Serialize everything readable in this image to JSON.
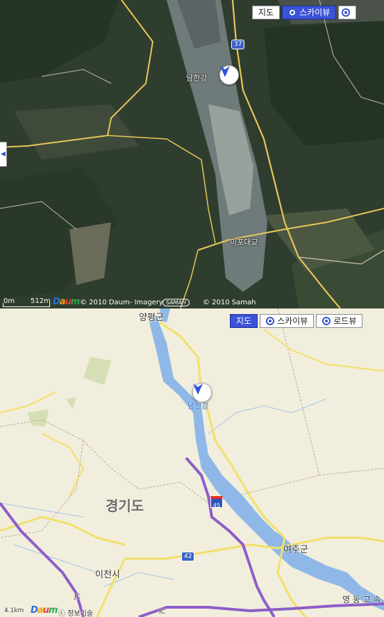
{
  "satellite": {
    "maptype_buttons": [
      "지도",
      "스카이뷰",
      ""
    ],
    "active_button": "스카이뷰",
    "labels": {
      "river": "남한강",
      "bridge": "이포대교",
      "road_37": "37"
    },
    "scale_zero": "0m",
    "scale_value": "512m",
    "copyright_daum": "© 2010 Daum- Imagery",
    "samah_logo": "SAMAH",
    "copyright_samah": "© 2010 Samah",
    "logo": {
      "d": "D",
      "a": "a",
      "u": "u",
      "m": "m"
    }
  },
  "map": {
    "maptype_buttons": [
      "지도",
      "스카이뷰",
      "로드뷰"
    ],
    "active_button": "지도",
    "labels": {
      "yangpyeong": "양평군",
      "river": "남한강",
      "gyeonggi": "경기도",
      "yeoju": "여주군",
      "icheon": "이천시",
      "expressway": "영 동  고 속",
      "jc": "JC",
      "ic": "IC",
      "road_42": "42",
      "hw_45": "45"
    },
    "scale_value": "4.1km",
    "copyright": "ⓒ 정보기술",
    "logo": {
      "d": "D",
      "a": "a",
      "u": "u",
      "m": "m"
    }
  },
  "colors": {
    "active": "#3b53d8",
    "river": "#8fb8e8",
    "highway": "#8e5dc9",
    "national_road": "#f2df6a",
    "satellite_road": "#e8c75a"
  }
}
